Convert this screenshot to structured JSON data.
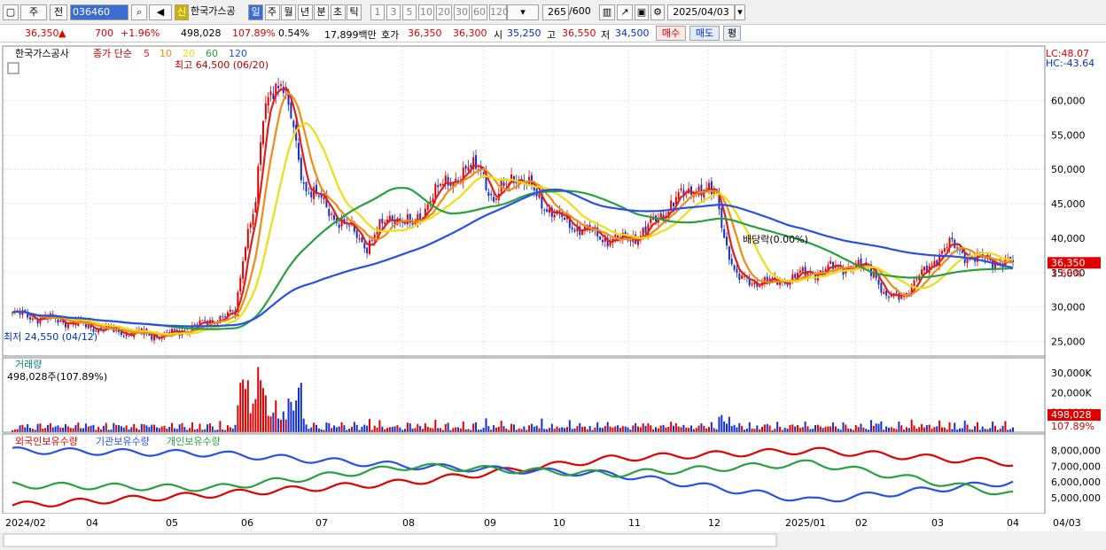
{
  "toolbar": {
    "market": "주",
    "period_button": "전",
    "code": "036460",
    "stock_name": "한국가스공",
    "new_label": "신",
    "intervals": [
      "일",
      "주",
      "월",
      "년",
      "분",
      "초",
      "틱"
    ],
    "minute_options": [
      "1",
      "3",
      "5",
      "10",
      "20",
      "30",
      "60",
      "120"
    ],
    "count": "265",
    "count_max": "/600",
    "date": "2025/04/03"
  },
  "quote": {
    "price": "36,350",
    "change": "700",
    "change_pct": "+1.96%",
    "volume": "498,028",
    "volume_ratio": "107.89%",
    "turnover": "0.54%",
    "amount": "17,899백만",
    "ask_label": "호가",
    "ask": "36,350",
    "bid": "36,300",
    "open_label": "시",
    "open": "35,250",
    "high_label": "고",
    "high": "36,550",
    "low_label": "저",
    "low": "34,500",
    "buy": "매수",
    "sell": "매도",
    "eval": "평"
  },
  "price_panel": {
    "stock_label": "한국가스공사",
    "ma_label": "종가 단순",
    "ma_periods": [
      "5",
      "10",
      "20",
      "60",
      "120"
    ],
    "ma_colors": [
      "#e02020",
      "#f08c14",
      "#f0dc14",
      "#28a040",
      "#2850e6"
    ],
    "max_label": "최고 64,500 (06/20)",
    "min_label": "최저 24,550 (04/12)",
    "dividend_label": "배당락(0.00%)",
    "lc_label": "LC:48.07",
    "hc_label": "HC:-43.64",
    "last_price": "36,350",
    "last_pct": "1.68%",
    "y_ticks": [
      "60,000",
      "55,000",
      "50,000",
      "45,000",
      "40,000",
      "35,000",
      "30,000",
      "25,000"
    ]
  },
  "volume_panel": {
    "title": "거래량",
    "summary": "498,028주(107.89%)",
    "y_ticks": [
      "30,000K",
      "20,000K",
      "10,000K"
    ],
    "last_volume": "498,028",
    "last_pct": "107.89%"
  },
  "holdings_panel": {
    "legend": [
      "외국인보유수량",
      "기관보유수량",
      "개인보유수량"
    ],
    "y_ticks": [
      "8,000,000",
      "7,000,000",
      "6,000,000",
      "5,000,000"
    ]
  },
  "x_axis": {
    "labels": [
      "2024/02",
      "04",
      "05",
      "06",
      "07",
      "08",
      "09",
      "10",
      "11",
      "12",
      "2025/01",
      "02",
      "03",
      "04"
    ],
    "last": "04/03"
  },
  "chart_data": {
    "type": "candlestick",
    "price_range": [
      23000,
      66500
    ],
    "series": [
      {
        "name": "종가",
        "key_points": [
          [
            0,
            29000
          ],
          [
            20,
            28000
          ],
          [
            40,
            26500
          ],
          [
            60,
            25800
          ],
          [
            75,
            27500
          ],
          [
            82,
            28500
          ],
          [
            88,
            29000
          ],
          [
            92,
            40000
          ],
          [
            96,
            45000
          ],
          [
            99,
            57000
          ],
          [
            102,
            62000
          ],
          [
            106,
            63000
          ],
          [
            110,
            57000
          ],
          [
            115,
            48000
          ],
          [
            125,
            44000
          ],
          [
            140,
            39000
          ],
          [
            150,
            43500
          ],
          [
            158,
            41500
          ],
          [
            165,
            46000
          ],
          [
            175,
            49000
          ],
          [
            185,
            50500
          ],
          [
            190,
            45000
          ],
          [
            198,
            49500
          ],
          [
            205,
            47000
          ],
          [
            215,
            43000
          ],
          [
            230,
            40500
          ],
          [
            240,
            39500
          ],
          [
            250,
            41000
          ],
          [
            260,
            45000
          ],
          [
            270,
            47500
          ],
          [
            278,
            46000
          ],
          [
            282,
            39000
          ],
          [
            286,
            34000
          ],
          [
            300,
            33500
          ],
          [
            315,
            35000
          ],
          [
            330,
            36000
          ],
          [
            340,
            35500
          ],
          [
            345,
            31000
          ],
          [
            352,
            32000
          ],
          [
            360,
            35000
          ],
          [
            365,
            37500
          ],
          [
            370,
            39000
          ],
          [
            380,
            37000
          ],
          [
            395,
            36350
          ]
        ]
      }
    ],
    "volume_range": [
      0,
      35000
    ],
    "holdings_range": [
      4200000,
      8600000
    ]
  }
}
